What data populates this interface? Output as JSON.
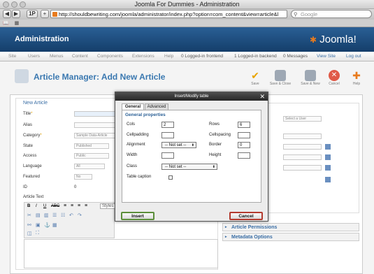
{
  "window": {
    "title": "Joomla For Dummies - Administration"
  },
  "browser": {
    "back": "◀",
    "forward": "▶",
    "share_label": "1P",
    "add_tab": "+",
    "url": "http://shouldbewriting.com/joomla/administrator/index.php?option=com_content&view=article&l",
    "search_placeholder": "Google"
  },
  "header": {
    "title": "Administration",
    "logo": "Joomla!"
  },
  "menu": {
    "items": [
      "Site",
      "Users",
      "Menus",
      "Content",
      "Components",
      "Extensions",
      "Help"
    ],
    "status": [
      "0 Logged-in frontend",
      "1 Logged-in backend",
      "0 Messages"
    ],
    "view_site": "View Site",
    "logout": "Log out"
  },
  "page": {
    "title": "Article Manager: Add New Article"
  },
  "toolbar": {
    "save": "Save",
    "save_close": "Save & Close",
    "save_new": "Save & New",
    "cancel": "Cancel",
    "help": "Help"
  },
  "form": {
    "legend": "New Article",
    "title_label": "Title",
    "alias_label": "Alias",
    "category_label": "Category",
    "category_value": "Sample Data-Article",
    "state_label": "State",
    "state_value": "Published",
    "access_label": "Access",
    "access_value": "Public",
    "language_label": "Language",
    "language_value": "All",
    "featured_label": "Featured",
    "featured_value": "No",
    "id_label": "ID",
    "id_value": "0",
    "text_label": "Article Text",
    "styles_label": "Styles"
  },
  "sidebar": {
    "options_title": "ons",
    "select_user": "Select a User",
    "permissions": "Article Permissions",
    "metadata": "Metadata Options"
  },
  "modal": {
    "title": "Insert/Modify table",
    "tabs": [
      "General",
      "Advanced"
    ],
    "legend": "General properties",
    "cols_label": "Cols",
    "cols_value": "2",
    "rows_label": "Rows",
    "rows_value": "6",
    "cellpadding_label": "Cellpadding",
    "cellspacing_label": "Cellspacing",
    "alignment_label": "Alignment",
    "alignment_value": "-- Not set --",
    "border_label": "Border",
    "border_value": "0",
    "width_label": "Width",
    "height_label": "Height",
    "class_label": "Class",
    "class_value": "-- Not set --",
    "caption_label": "Table caption",
    "insert": "Insert",
    "cancel": "Cancel"
  }
}
